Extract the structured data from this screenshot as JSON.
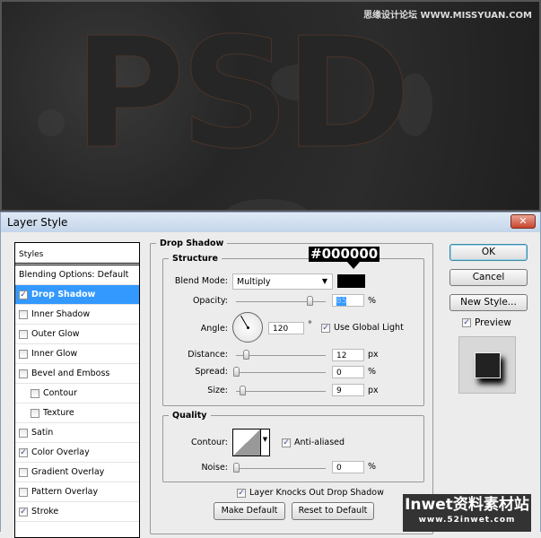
{
  "canvas": {
    "artwork_text": "PSD",
    "watermark": "思缘设计论坛 WWW.MISSYUAN.COM"
  },
  "dialog": {
    "title": "Layer Style",
    "close_icon": "close-icon"
  },
  "styles": {
    "header": "Styles",
    "items": [
      {
        "label": "Blending Options: Default",
        "checkbox": false,
        "checked": false,
        "selected": false,
        "sub": false
      },
      {
        "label": "Drop Shadow",
        "checkbox": true,
        "checked": true,
        "selected": true,
        "sub": false
      },
      {
        "label": "Inner Shadow",
        "checkbox": true,
        "checked": false,
        "selected": false,
        "sub": false
      },
      {
        "label": "Outer Glow",
        "checkbox": true,
        "checked": false,
        "selected": false,
        "sub": false
      },
      {
        "label": "Inner Glow",
        "checkbox": true,
        "checked": false,
        "selected": false,
        "sub": false
      },
      {
        "label": "Bevel and Emboss",
        "checkbox": true,
        "checked": false,
        "selected": false,
        "sub": false
      },
      {
        "label": "Contour",
        "checkbox": true,
        "checked": false,
        "selected": false,
        "sub": true
      },
      {
        "label": "Texture",
        "checkbox": true,
        "checked": false,
        "selected": false,
        "sub": true
      },
      {
        "label": "Satin",
        "checkbox": true,
        "checked": false,
        "selected": false,
        "sub": false
      },
      {
        "label": "Color Overlay",
        "checkbox": true,
        "checked": true,
        "selected": false,
        "sub": false
      },
      {
        "label": "Gradient Overlay",
        "checkbox": true,
        "checked": false,
        "selected": false,
        "sub": false
      },
      {
        "label": "Pattern Overlay",
        "checkbox": true,
        "checked": false,
        "selected": false,
        "sub": false
      },
      {
        "label": "Stroke",
        "checkbox": true,
        "checked": true,
        "selected": false,
        "sub": false
      }
    ]
  },
  "drop_shadow": {
    "title": "Drop Shadow",
    "structure": {
      "title": "Structure",
      "blend_mode_label": "Blend Mode:",
      "blend_mode": "Multiply",
      "color_annotation": "#000000",
      "color": "#000000",
      "opacity_label": "Opacity:",
      "opacity": "85",
      "opacity_unit": "%",
      "angle_label": "Angle:",
      "angle": "120",
      "angle_unit": "°",
      "global_light_label": "Use Global Light",
      "global_light": true,
      "distance_label": "Distance:",
      "distance": "12",
      "distance_unit": "px",
      "spread_label": "Spread:",
      "spread": "0",
      "spread_unit": "%",
      "size_label": "Size:",
      "size": "9",
      "size_unit": "px"
    },
    "quality": {
      "title": "Quality",
      "contour_label": "Contour:",
      "anti_aliased_label": "Anti-aliased",
      "anti_aliased": true,
      "noise_label": "Noise:",
      "noise": "0",
      "noise_unit": "%"
    },
    "knockout_label": "Layer Knocks Out Drop Shadow",
    "knockout": true,
    "make_default": "Make Default",
    "reset_default": "Reset to Default"
  },
  "buttons": {
    "ok": "OK",
    "cancel": "Cancel",
    "new_style": "New Style...",
    "preview_label": "Preview",
    "preview": true
  },
  "watermark2": {
    "line1": "Inwet资料素材站",
    "line2": "www.52inwet.com"
  },
  "colors": {
    "selection": "#3399ff",
    "titlebar": "#c4d5ea"
  }
}
